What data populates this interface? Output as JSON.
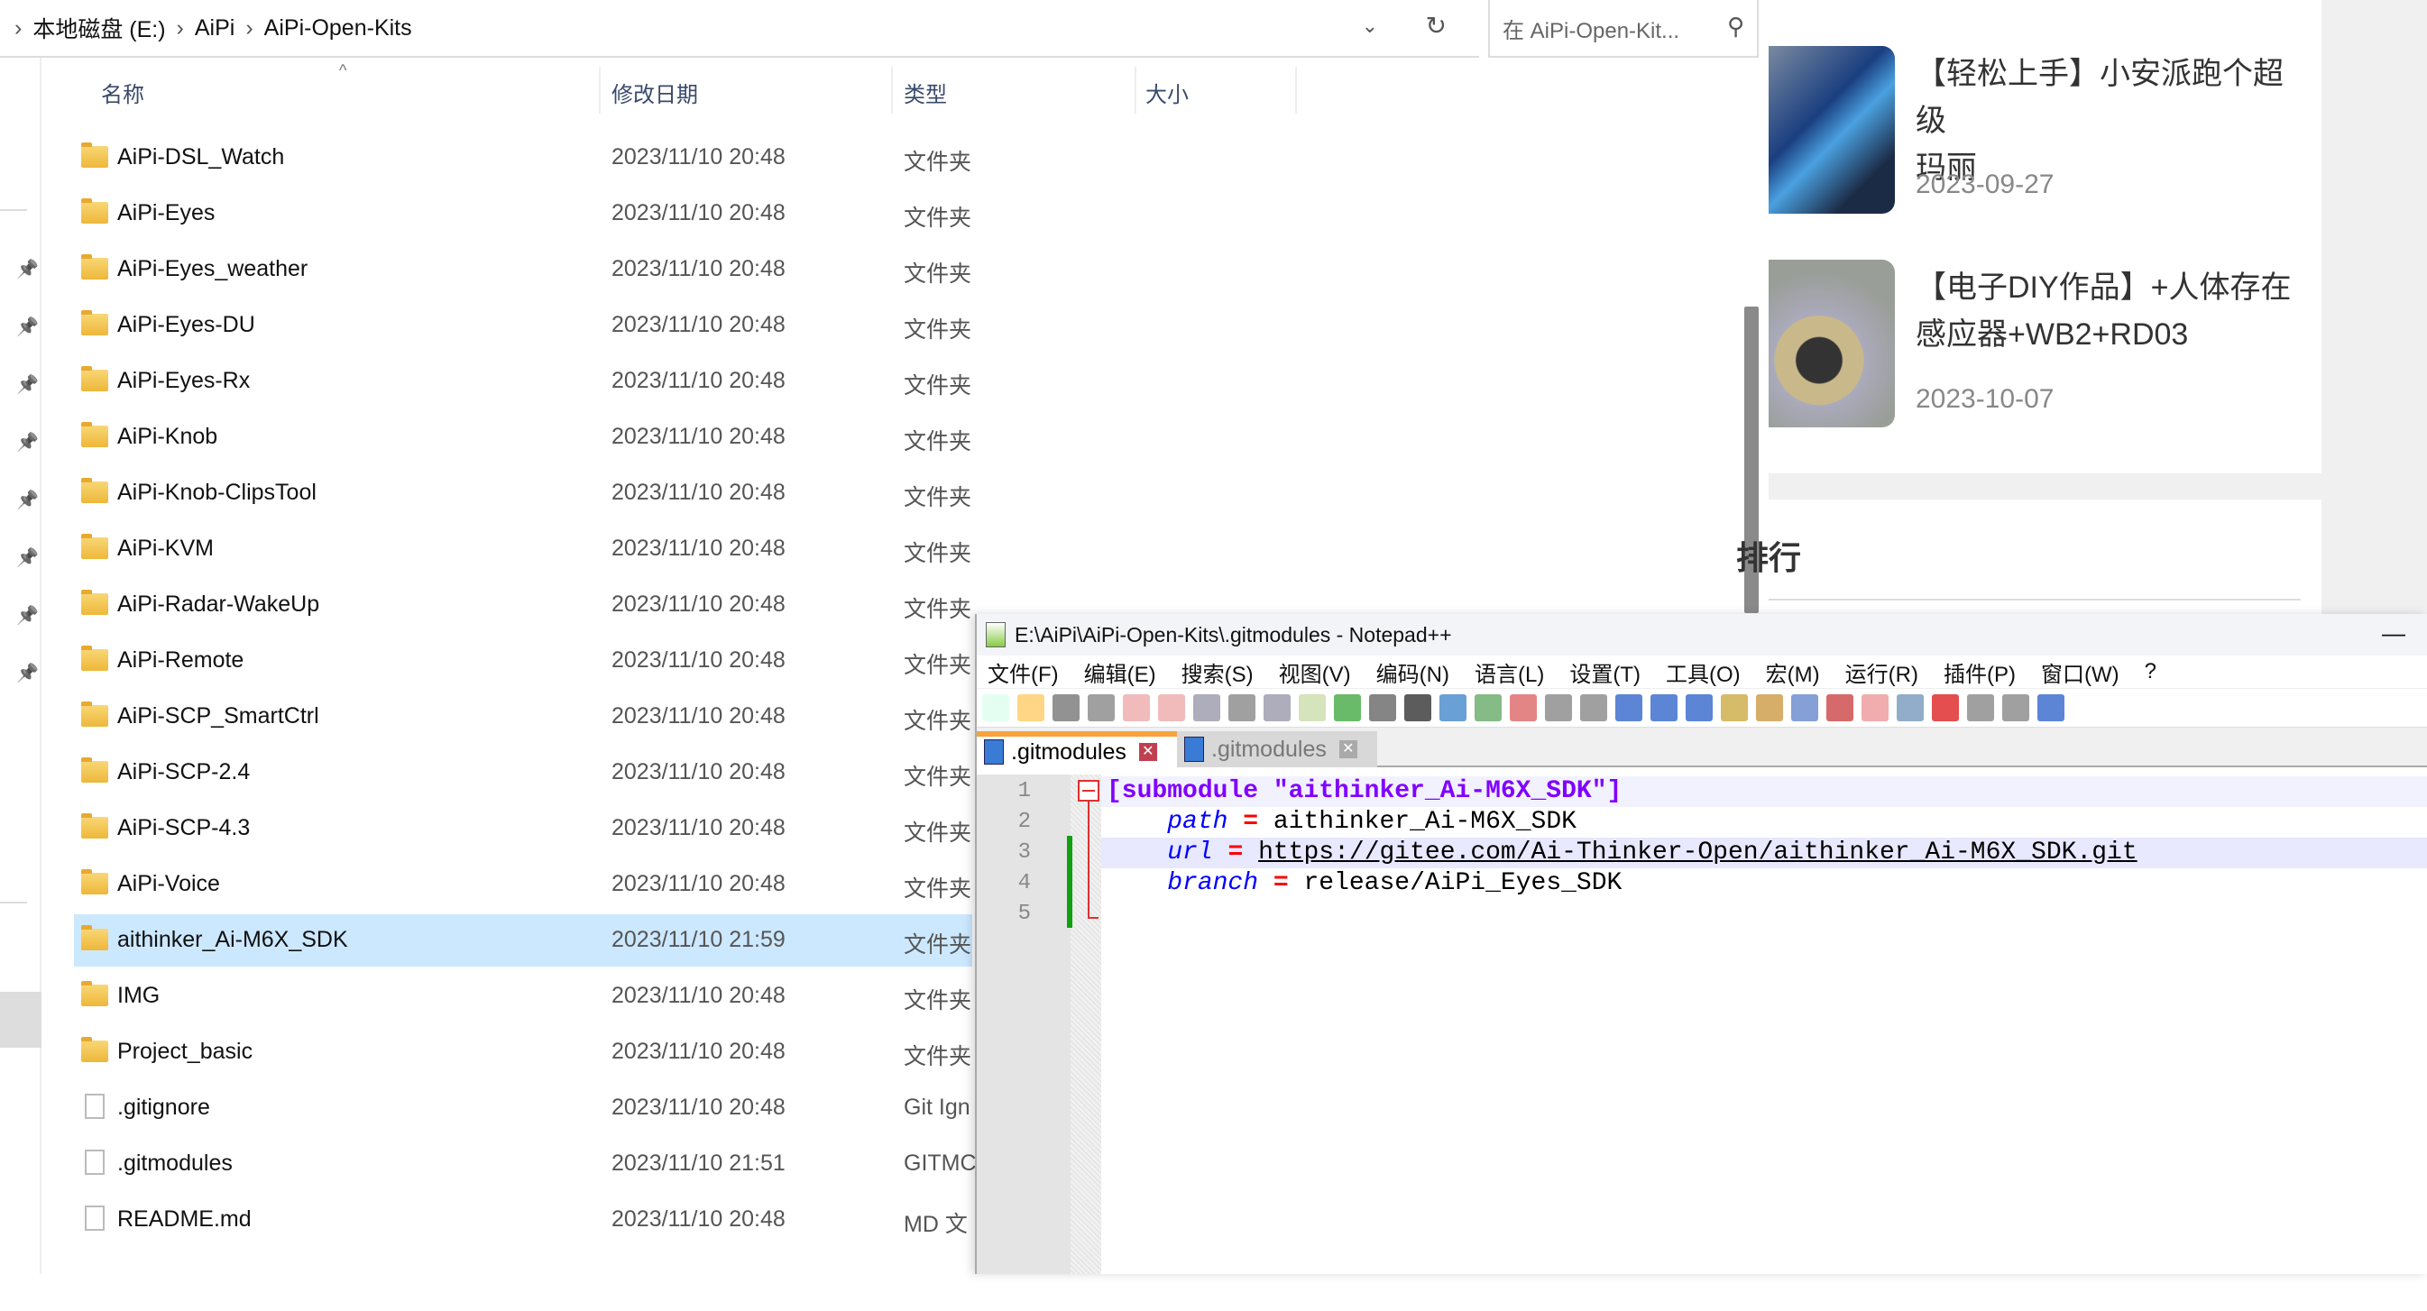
{
  "explorer": {
    "breadcrumb": [
      "本地磁盘 (E:)",
      "AiPi",
      "AiPi-Open-Kits"
    ],
    "search_placeholder": "在 AiPi-Open-Kit...",
    "columns": {
      "name": "名称",
      "date": "修改日期",
      "type": "类型",
      "size": "大小"
    },
    "rows": [
      {
        "name": "AiPi-DSL_Watch",
        "date": "2023/11/10 20:48",
        "type": "文件夹",
        "icon": "folder"
      },
      {
        "name": "AiPi-Eyes",
        "date": "2023/11/10 20:48",
        "type": "文件夹",
        "icon": "folder"
      },
      {
        "name": "AiPi-Eyes_weather",
        "date": "2023/11/10 20:48",
        "type": "文件夹",
        "icon": "folder"
      },
      {
        "name": "AiPi-Eyes-DU",
        "date": "2023/11/10 20:48",
        "type": "文件夹",
        "icon": "folder"
      },
      {
        "name": "AiPi-Eyes-Rx",
        "date": "2023/11/10 20:48",
        "type": "文件夹",
        "icon": "folder"
      },
      {
        "name": "AiPi-Knob",
        "date": "2023/11/10 20:48",
        "type": "文件夹",
        "icon": "folder"
      },
      {
        "name": "AiPi-Knob-ClipsTool",
        "date": "2023/11/10 20:48",
        "type": "文件夹",
        "icon": "folder"
      },
      {
        "name": "AiPi-KVM",
        "date": "2023/11/10 20:48",
        "type": "文件夹",
        "icon": "folder"
      },
      {
        "name": "AiPi-Radar-WakeUp",
        "date": "2023/11/10 20:48",
        "type": "文件夹",
        "icon": "folder"
      },
      {
        "name": "AiPi-Remote",
        "date": "2023/11/10 20:48",
        "type": "文件夹",
        "icon": "folder"
      },
      {
        "name": "AiPi-SCP_SmartCtrl",
        "date": "2023/11/10 20:48",
        "type": "文件夹",
        "icon": "folder"
      },
      {
        "name": "AiPi-SCP-2.4",
        "date": "2023/11/10 20:48",
        "type": "文件夹",
        "icon": "folder"
      },
      {
        "name": "AiPi-SCP-4.3",
        "date": "2023/11/10 20:48",
        "type": "文件夹",
        "icon": "folder"
      },
      {
        "name": "AiPi-Voice",
        "date": "2023/11/10 20:48",
        "type": "文件夹",
        "icon": "folder"
      },
      {
        "name": "aithinker_Ai-M6X_SDK",
        "date": "2023/11/10 21:59",
        "type": "文件夹",
        "icon": "folder",
        "selected": true
      },
      {
        "name": "IMG",
        "date": "2023/11/10 20:48",
        "type": "文件夹",
        "icon": "folder"
      },
      {
        "name": "Project_basic",
        "date": "2023/11/10 20:48",
        "type": "文件夹",
        "icon": "folder"
      },
      {
        "name": ".gitignore",
        "date": "2023/11/10 20:48",
        "type": "Git Ign",
        "icon": "file"
      },
      {
        "name": ".gitmodules",
        "date": "2023/11/10 21:51",
        "type": "GITMC",
        "icon": "file"
      },
      {
        "name": "README.md",
        "date": "2023/11/10 20:48",
        "type": "MD 文",
        "icon": "file"
      }
    ]
  },
  "web": {
    "articles": [
      {
        "title_lines": [
          "【轻松上手】小安派跑个超级",
          "玛丽"
        ],
        "date": "2023-09-27"
      },
      {
        "title_lines": [
          "【电子DIY作品】+人体存在",
          "感应器+WB2+RD03"
        ],
        "date": "2023-10-07"
      }
    ],
    "section_heading": "排行"
  },
  "npp": {
    "title": "E:\\AiPi\\AiPi-Open-Kits\\.gitmodules - Notepad++",
    "menu": [
      "文件(F)",
      "编辑(E)",
      "搜索(S)",
      "视图(V)",
      "编码(N)",
      "语言(L)",
      "设置(T)",
      "工具(O)",
      "宏(M)",
      "运行(R)",
      "插件(P)",
      "窗口(W)",
      "?"
    ],
    "toolbar_icons": [
      "new-file",
      "open",
      "save",
      "save-all",
      "close",
      "close-all",
      "print",
      "cut",
      "copy",
      "paste",
      "undo",
      "redo",
      "find",
      "replace",
      "zoom-in",
      "zoom-out",
      "sync-v",
      "sync-h",
      "word-wrap",
      "show-all",
      "indent-guide",
      "udl",
      "doc-map",
      "func-list",
      "folder-workspace",
      "monitor",
      "record",
      "stop",
      "play",
      "play-multi",
      "save-macro"
    ],
    "tabs": [
      {
        "label": ".gitmodules",
        "active": true
      },
      {
        "label": ".gitmodules",
        "active": false
      }
    ],
    "lines": [
      {
        "num": "1",
        "parts": [
          {
            "c": "sec",
            "t": "[submodule \"aithinker_Ai-M6X_SDK\"]"
          }
        ]
      },
      {
        "num": "2",
        "parts": [
          {
            "c": "val",
            "t": "    "
          },
          {
            "c": "key",
            "t": "path"
          },
          {
            "c": "val",
            "t": " "
          },
          {
            "c": "eq",
            "t": "="
          },
          {
            "c": "val",
            "t": " aithinker_Ai-M6X_SDK"
          }
        ]
      },
      {
        "num": "3",
        "parts": [
          {
            "c": "val",
            "t": "    "
          },
          {
            "c": "key",
            "t": "url"
          },
          {
            "c": "val",
            "t": " "
          },
          {
            "c": "eq",
            "t": "="
          },
          {
            "c": "val",
            "t": " "
          },
          {
            "c": "url",
            "t": "https://gitee.com/Ai-Thinker-Open/aithinker_Ai-M6X_SDK.git"
          }
        ]
      },
      {
        "num": "4",
        "parts": [
          {
            "c": "val",
            "t": "    "
          },
          {
            "c": "key",
            "t": "branch"
          },
          {
            "c": "val",
            "t": " "
          },
          {
            "c": "eq",
            "t": "="
          },
          {
            "c": "val",
            "t": " release/AiPi_Eyes_SDK"
          }
        ]
      },
      {
        "num": "5",
        "parts": []
      }
    ]
  }
}
